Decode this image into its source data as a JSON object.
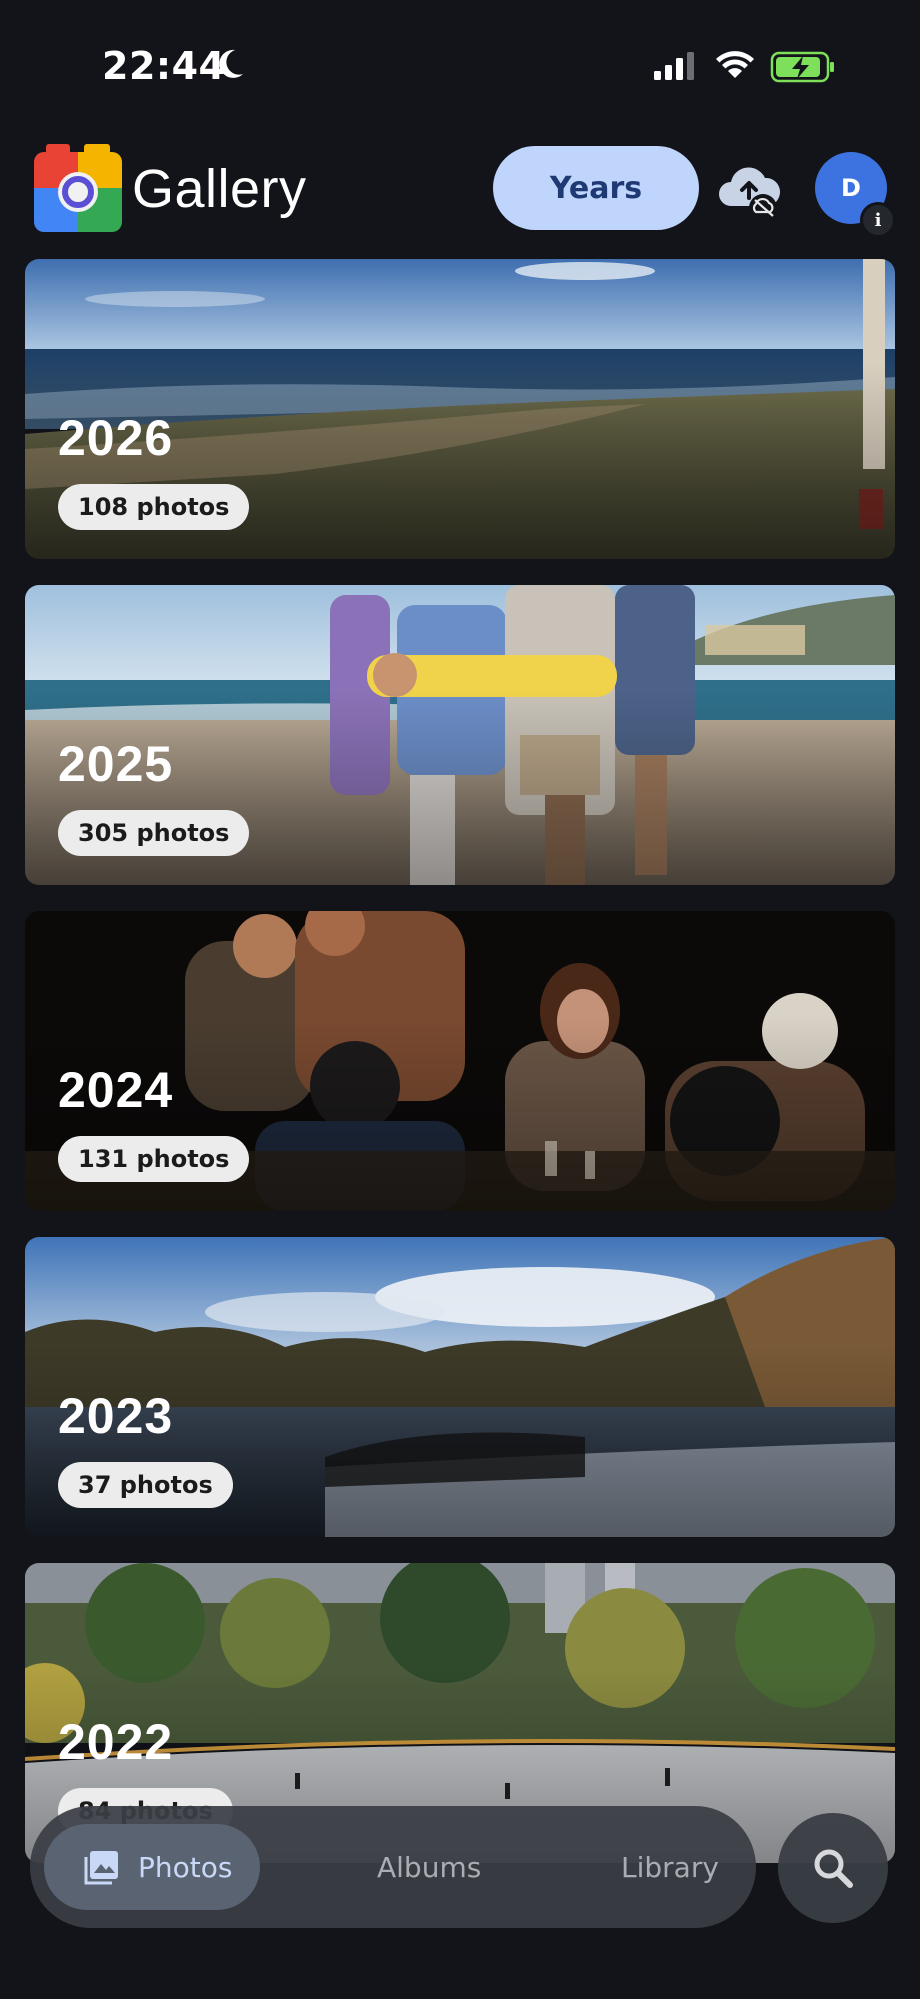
{
  "status_bar": {
    "time": "22:44"
  },
  "header": {
    "app_title": "Gallery",
    "years_button": "Years",
    "avatar_initial": "D",
    "avatar_badge": "i"
  },
  "year_cards": [
    {
      "year": "2026",
      "count": "108 photos",
      "scene": "beach-shoreline"
    },
    {
      "year": "2025",
      "count": "305 photos",
      "scene": "friends-on-beach"
    },
    {
      "year": "2024",
      "count": "131 photos",
      "scene": "dinner-party"
    },
    {
      "year": "2023",
      "count": "37 photos",
      "scene": "lake-autumn"
    },
    {
      "year": "2022",
      "count": "84 photos",
      "scene": "park-ice-rink"
    }
  ],
  "bottom_nav": {
    "items": [
      {
        "label": "Photos",
        "active": true
      },
      {
        "label": "Albums",
        "active": false
      },
      {
        "label": "Library",
        "active": false
      }
    ]
  },
  "icons": {
    "moon": "moon-icon",
    "signal": "cellular-signal-icon",
    "wifi": "wifi-icon",
    "battery": "battery-charging-icon",
    "cloud": "cloud-upload-off-icon",
    "search": "search-icon"
  },
  "colors": {
    "background": "#12141a",
    "years_button": "#bfd5fb",
    "avatar": "#3d73e0",
    "battery": "#7ee05a"
  }
}
